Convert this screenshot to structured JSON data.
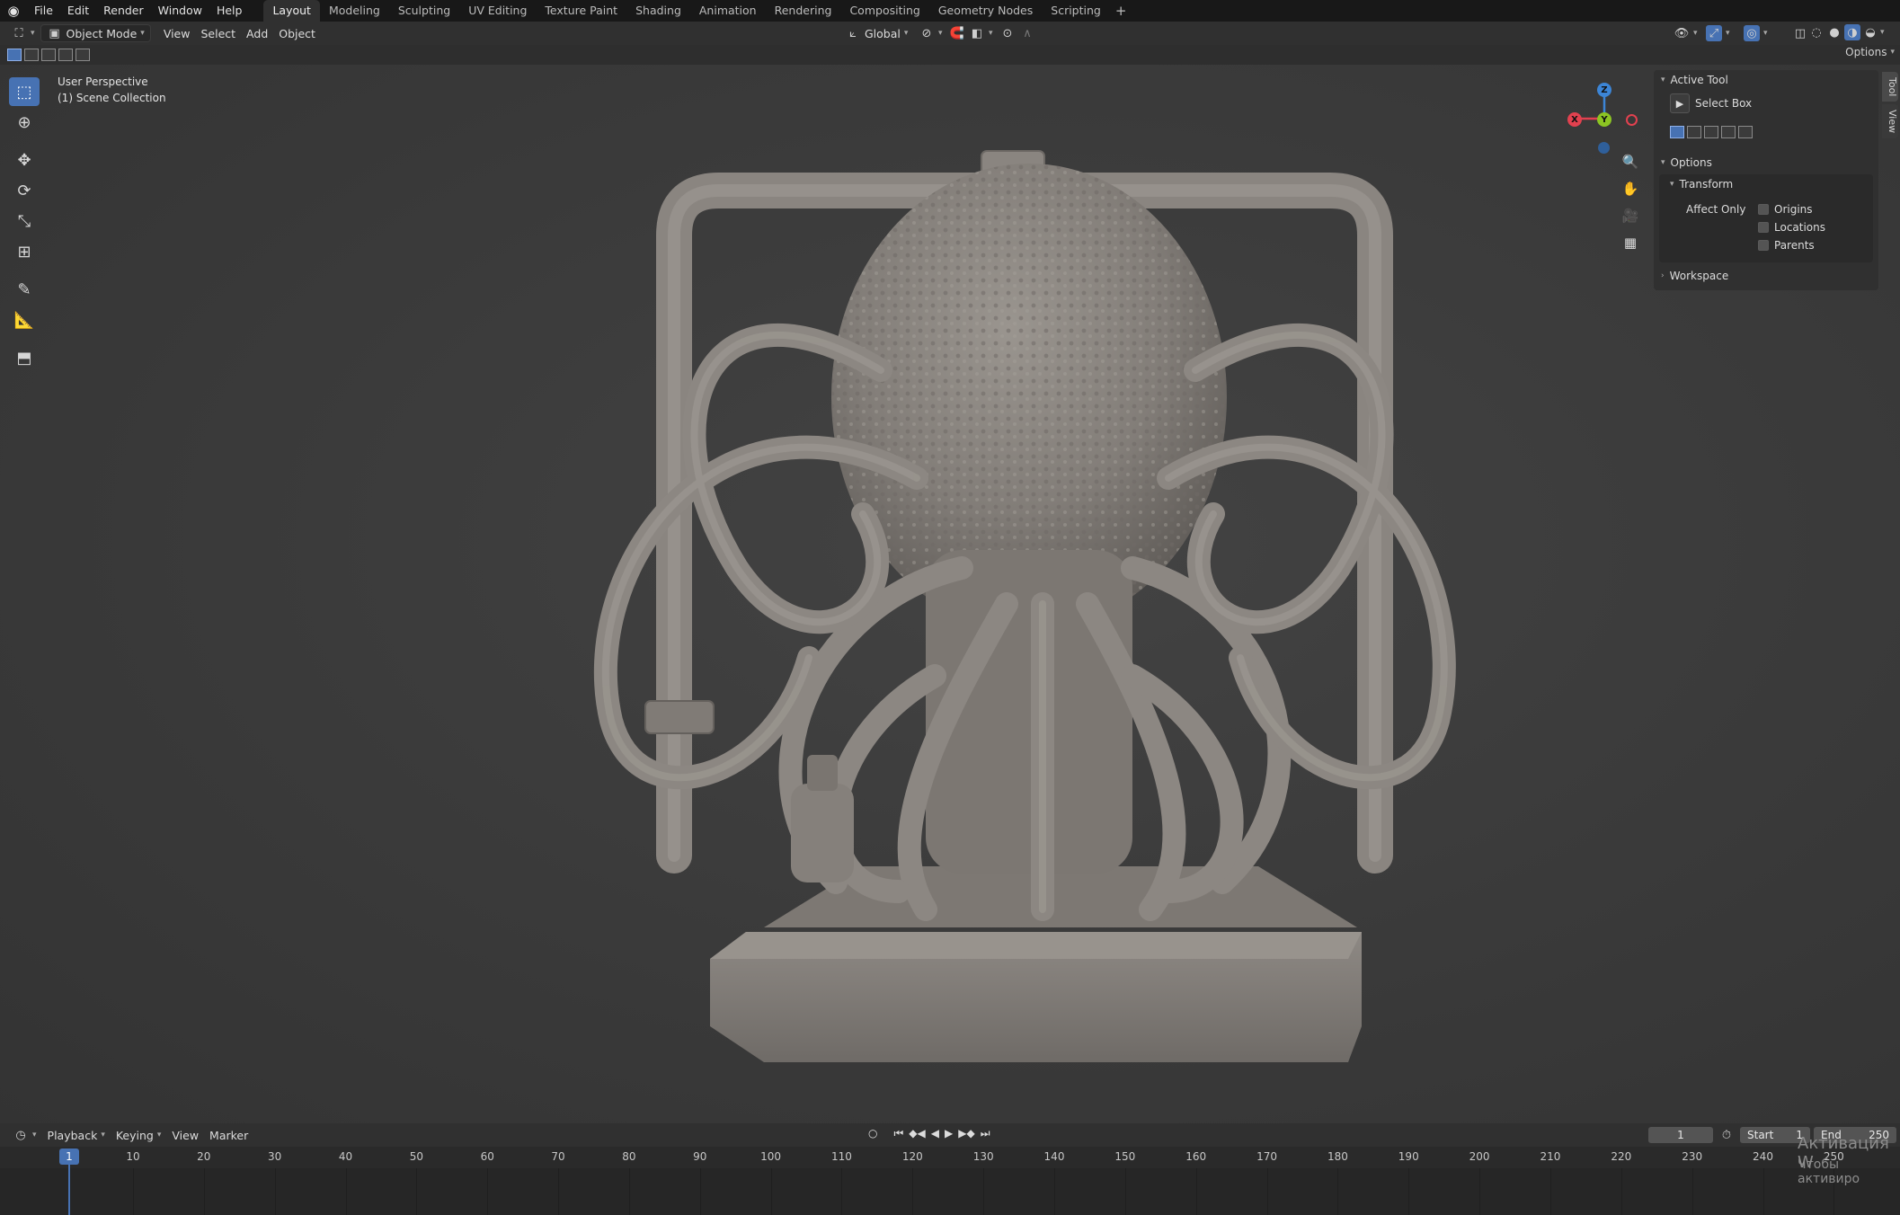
{
  "menu": {
    "items": [
      "File",
      "Edit",
      "Render",
      "Window",
      "Help"
    ]
  },
  "workspace_tabs": [
    "Layout",
    "Modeling",
    "Sculpting",
    "UV Editing",
    "Texture Paint",
    "Shading",
    "Animation",
    "Rendering",
    "Compositing",
    "Geometry Nodes",
    "Scripting"
  ],
  "workspace_active": "Layout",
  "viewport_header": {
    "mode": "Object Mode",
    "menus": [
      "View",
      "Select",
      "Add",
      "Object"
    ],
    "orientation": "Global",
    "options_label": "Options"
  },
  "viewport": {
    "perspective_label": "User Perspective",
    "collection_label": "(1) Scene Collection",
    "gizmo": {
      "x": "X",
      "y": "Y",
      "z": "Z",
      "x_color": "#e2414f",
      "y_color": "#8cc523",
      "z_color": "#3c85d6"
    }
  },
  "n_panel": {
    "active_tool_title": "Active Tool",
    "tool_name": "Select Box",
    "options_title": "Options",
    "transform_title": "Transform",
    "affect_only_label": "Affect Only",
    "checkboxes": [
      "Origins",
      "Locations",
      "Parents"
    ],
    "workspace_title": "Workspace",
    "side_tabs": [
      "Tool",
      "View"
    ]
  },
  "timeline": {
    "menus": [
      "Playback",
      "Keying",
      "View",
      "Marker"
    ],
    "current_frame": "1",
    "start_label": "Start",
    "start_value": "1",
    "end_label": "End",
    "end_value": "250",
    "ticks": [
      "1",
      "10",
      "20",
      "30",
      "40",
      "50",
      "60",
      "70",
      "80",
      "90",
      "100",
      "110",
      "120",
      "130",
      "140",
      "150",
      "160",
      "170",
      "180",
      "190",
      "200",
      "210",
      "220",
      "230",
      "240",
      "250"
    ]
  },
  "watermark": {
    "line1": "Активация W",
    "line2": "Чтобы активиро"
  },
  "colors": {
    "accent": "#4772b3",
    "model": "#8a8580"
  }
}
